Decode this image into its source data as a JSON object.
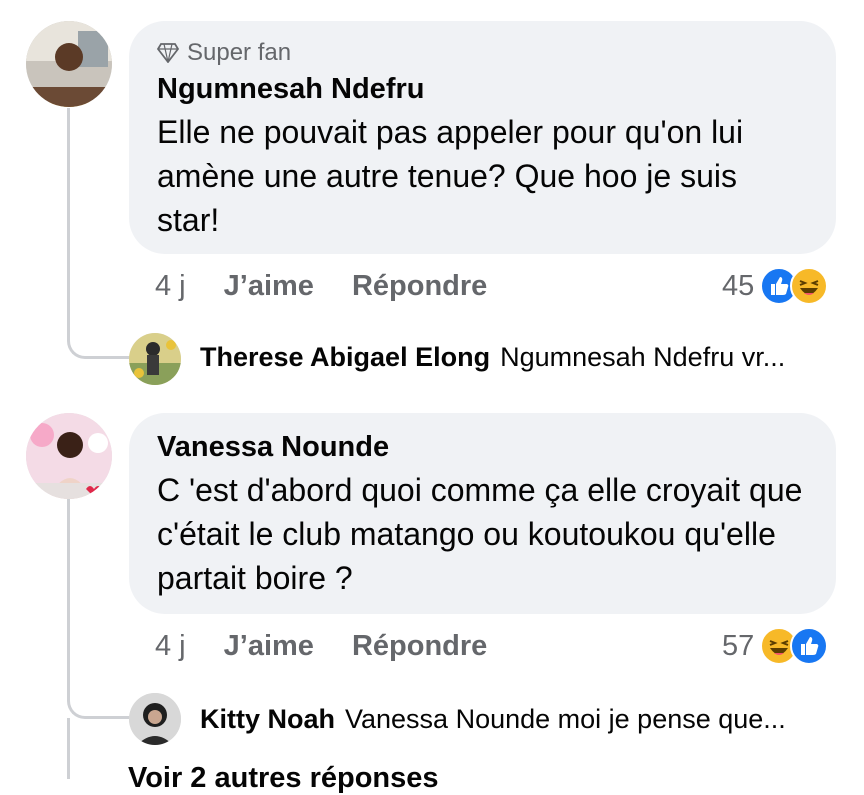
{
  "comments": [
    {
      "badge": "Super fan",
      "author": "Ngumnesah Ndefru",
      "text": "Elle ne pouvait pas appeler pour qu'on lui amène une autre tenue? Que hoo je suis star!",
      "time": "4 j",
      "like_label": "J’aime",
      "reply_label": "Répondre",
      "reaction_count": "45",
      "reactions": [
        "like-icon",
        "haha-icon"
      ],
      "reply": {
        "author": "Therese Abigael Elong",
        "snippet": "Ngumnesah Ndefru vr..."
      }
    },
    {
      "author": "Vanessa Nounde",
      "text": "C 'est d'abord quoi comme ça elle croyait que c'était le club matango ou koutoukou qu'elle partait boire ?",
      "time": "4 j",
      "like_label": "J’aime",
      "reply_label": "Répondre",
      "reaction_count": "57",
      "reactions": [
        "haha-icon",
        "like-icon"
      ],
      "reply": {
        "author": "Kitty Noah",
        "snippet": "Vanessa Nounde moi je pense que..."
      }
    }
  ],
  "more_replies_label": "Voir 2 autres réponses",
  "colors": {
    "bubble": "#f0f2f5",
    "like_blue": "#1877f2",
    "haha_yellow": "#f7b928",
    "secondary_text": "#65676b"
  }
}
